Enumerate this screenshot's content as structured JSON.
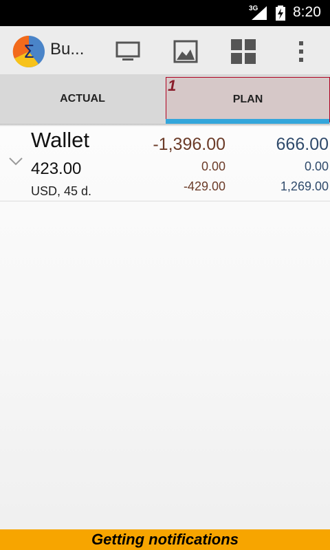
{
  "status_bar": {
    "network": "3G",
    "time": "8:20"
  },
  "action_bar": {
    "title": "Bu...",
    "actions": [
      "desktop-icon",
      "image-icon",
      "grid-icon",
      "overflow-menu-icon"
    ]
  },
  "tabs": [
    {
      "label": "ACTUAL",
      "selected": false
    },
    {
      "label": "PLAN",
      "selected": true
    }
  ],
  "tab_marker": "1",
  "account": {
    "name": "Wallet",
    "balance": "423.00",
    "meta": "USD, 45 d.",
    "actual": {
      "main": "-1,396.00",
      "row2": "0.00",
      "row3": "-429.00"
    },
    "plan": {
      "main": "666.00",
      "row2": "0.00",
      "row3": "1,269.00"
    }
  },
  "banner": {
    "text": "Getting notifications"
  },
  "colors": {
    "accent": "#33a6db",
    "actual_values": "#6b3b28",
    "plan_values": "#2f4a6b",
    "banner": "#f7a500"
  }
}
